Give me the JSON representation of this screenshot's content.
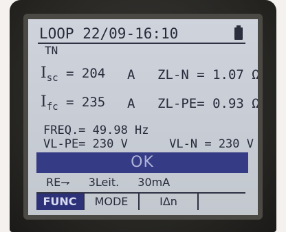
{
  "header": {
    "mode": "LOOP",
    "datetime": "22/09-16:10",
    "battery_icon": "battery-full-icon"
  },
  "system": "TN",
  "measurements": {
    "isc": {
      "symbol": "I",
      "subscript": "sc",
      "value": "= 204",
      "unit": "A"
    },
    "ifc": {
      "symbol": "I",
      "subscript": "fc",
      "value": "= 235",
      "unit": "A"
    },
    "zl_n": "ZL-N = 1.07 Ω",
    "zl_pe": "ZL-PE= 0.93 Ω",
    "freq": "FREQ.= 49.98 Hz",
    "vl_pe": "VL-PE= 230 V",
    "vl_n": "VL-N = 230 V"
  },
  "status": "OK",
  "settings": {
    "re": "RE⇁",
    "leiter": "3Leit.",
    "current": "30mA"
  },
  "softkeys": {
    "func": "FUNC",
    "mode": "MODE",
    "idn": "IΔn",
    "empty": ""
  },
  "colors": {
    "lcd_bg": "#c9cdd5",
    "lcd_text": "#262a3a",
    "ok_bar": "#363b85",
    "device": "#262522"
  }
}
